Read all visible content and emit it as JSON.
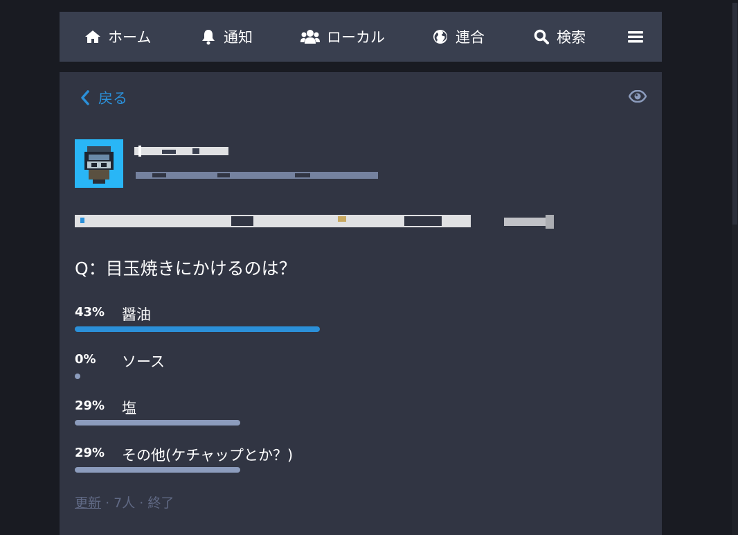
{
  "nav": {
    "items": [
      {
        "label": "ホーム",
        "icon": "home-icon"
      },
      {
        "label": "通知",
        "icon": "bell-icon"
      },
      {
        "label": "ローカル",
        "icon": "users-icon"
      },
      {
        "label": "連合",
        "icon": "globe-icon"
      },
      {
        "label": "検索",
        "icon": "search-icon"
      }
    ],
    "menu_icon": "hamburger-menu-icon"
  },
  "header": {
    "back_label": "戻る",
    "visibility_icon": "eye-icon"
  },
  "colors": {
    "accent": "#2b90d9",
    "bar_leading": "#2b90d9",
    "bar_other": "#8c9cbd",
    "muted": "#606984",
    "panel": "#313543",
    "topbar": "#393f4f",
    "background": "#191b22"
  },
  "status": {
    "question": "Q：目玉焼きにかけるのは？"
  },
  "poll": {
    "options": [
      {
        "percent_label": "43%",
        "label": "醤油",
        "percent": 43,
        "leading": true
      },
      {
        "percent_label": "0%",
        "label": "ソース",
        "percent": 0,
        "leading": false
      },
      {
        "percent_label": "29%",
        "label": "塩",
        "percent": 29,
        "leading": false
      },
      {
        "percent_label": "29%",
        "label": "その他(ケチャップとか？)",
        "percent": 29,
        "leading": false
      }
    ],
    "refresh_label": "更新",
    "voters": "7人",
    "state": "終了",
    "separator": "·"
  }
}
